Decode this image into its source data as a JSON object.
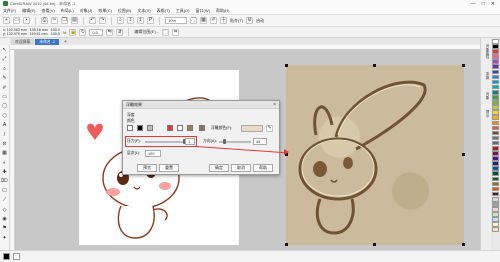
{
  "window": {
    "title": "CorelDRAW 2019 (64-bit) - 未命名 -1",
    "controls": [
      "—",
      "□",
      "✕"
    ]
  },
  "menu": [
    "文件(F)",
    "编辑(E)",
    "查看(V)",
    "布局(L)",
    "对象(J)",
    "效果(C)",
    "位图(B)",
    "文本(X)",
    "表格(T)",
    "工具(O)",
    "窗口(W)",
    "帮助(H)"
  ],
  "toolbar": {
    "zoom": "10%",
    "snap_label": "贴齐(T)",
    "options_label": "启动"
  },
  "propbar": {
    "x": "x: 102.063 mm",
    "y": "y: 132.479 mm",
    "w": "135.16 mm",
    "h": "119.51 mm",
    "sx": "100.0",
    "sy": "100.0",
    "unit": "%",
    "angle": "0.0",
    "edit_label": "编辑位图(E)..."
  },
  "tabs": {
    "welcome": "欢迎屏幕",
    "doc": "未命名 -1",
    "add": "+"
  },
  "tools": [
    "↖",
    "⤢",
    "⌕",
    "✎",
    "✐",
    "▭",
    "◯",
    "⬡",
    "A",
    "/",
    "⊘",
    "▦",
    "◐",
    "✚",
    "⌦",
    "☐",
    "⟋",
    "◇",
    "◉",
    "⚑",
    "✦"
  ],
  "dialog": {
    "title": "浮雕效果",
    "section_label": "颜色",
    "depth_label": "深度",
    "direction_label": "浮雕颜色(F):",
    "level_label": "层次(L):",
    "level_value": "100",
    "angle_label": "方向(A):",
    "angle_value": "45",
    "pressure_label": "压力(P):",
    "pressure_value": "1",
    "preview_label": "预览",
    "reset_label": "重置",
    "ok_label": "确定",
    "cancel_label": "取消",
    "help_label": "帮助",
    "close_icon": "close-icon"
  },
  "right_panel": {
    "tabs": [
      "对象属性",
      "变换",
      "对象",
      "提示"
    ]
  },
  "palette": [
    "#ffffff",
    "#000000",
    "#e53935",
    "#f06292",
    "#ab47bc",
    "#5e35b1",
    "#3949ab",
    "#1e88e5",
    "#039be5",
    "#00acc1",
    "#00897b",
    "#43a047",
    "#7cb342",
    "#c0ca33",
    "#fdd835",
    "#ffb300",
    "#fb8c00",
    "#f4511e",
    "#6d4c41",
    "#757575",
    "#546e7a",
    "#b71c1c",
    "#880e4f",
    "#4a148c",
    "#1a237e",
    "#01579b",
    "#004d40",
    "#1b5e20",
    "#827717",
    "#e65100",
    "#3e2723",
    "#cfd8dc",
    "#9e9e9e",
    "#ffcdd2",
    "#c8e6c9",
    "#bbdefb",
    "#fff9c4",
    "#ffe0b2"
  ],
  "accent": "#3b78c4",
  "annotation_color": "#e53935"
}
